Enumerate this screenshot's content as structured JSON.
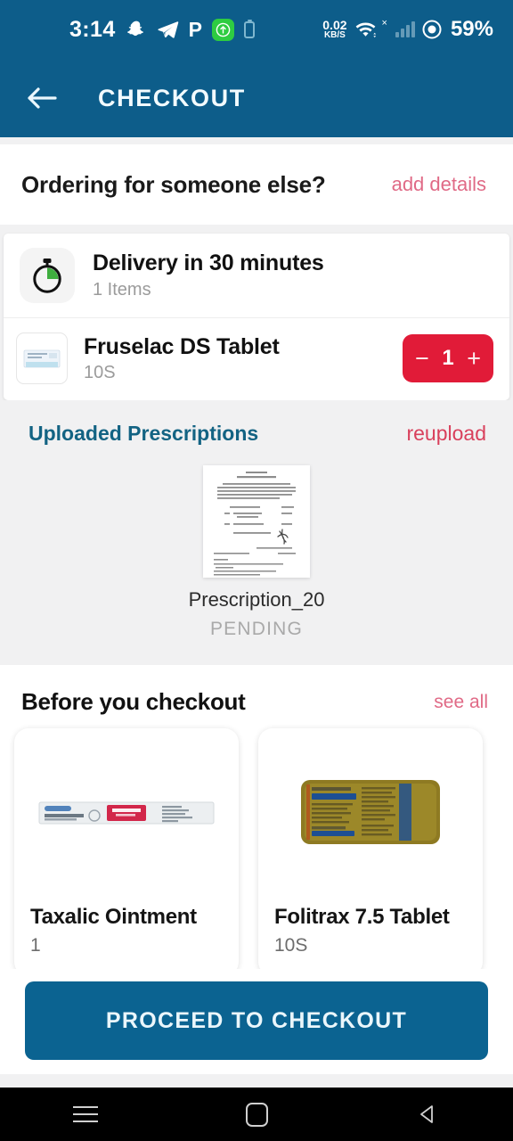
{
  "statusbar": {
    "time": "3:14",
    "icons_left": [
      "snapchat-icon",
      "telegram-icon",
      "p-letter-icon",
      "green-uploading-icon",
      "small-battery-icon"
    ],
    "p_label": "P",
    "net_speed_value": "0.02",
    "net_speed_unit": "KB/S",
    "signal_x": "×",
    "battery_percent": "59%"
  },
  "appbar": {
    "back_icon": "back-arrow-icon",
    "title": "CHECKOUT"
  },
  "order_for_else": {
    "question": "Ordering for someone else?",
    "action_label": "add details"
  },
  "delivery": {
    "icon": "stopwatch-icon",
    "title": "Delivery in 30 minutes",
    "subtitle": "1 Items"
  },
  "cart_item": {
    "thumb": "medicine-box-thumbnail",
    "name": "Fruselac DS Tablet",
    "pack": "10S",
    "stepper": {
      "decrement": "−",
      "quantity": "1",
      "increment": "+"
    }
  },
  "prescriptions": {
    "title": "Uploaded Prescriptions",
    "reupload_label": "reupload",
    "items": [
      {
        "thumb": "prescription-scan-thumbnail",
        "name": "Prescription_20",
        "status": "PENDING"
      }
    ]
  },
  "before_checkout": {
    "title": "Before you checkout",
    "see_all_label": "see all",
    "products": [
      {
        "name": "Taxalic Ointment",
        "pack": "1",
        "image": "taxalic-ointment-box"
      },
      {
        "name": "Folitrax 7.5 Tablet",
        "pack": "10S",
        "image": "folitrax-blister-strip"
      }
    ]
  },
  "cta": {
    "label": "PROCEED TO CHECKOUT"
  },
  "navbar": {
    "recents_icon": "recents-icon",
    "home_icon": "home-icon",
    "back_icon": "back-triangle-icon"
  },
  "colors": {
    "header_blue": "#0d5d8a",
    "cta_blue": "#0b6391",
    "accent_red": "#e11b38",
    "link_pink": "#e06a86",
    "reupload_red": "#d9405c",
    "rx_title_teal": "#136383",
    "page_bg": "#f1f1f2"
  }
}
